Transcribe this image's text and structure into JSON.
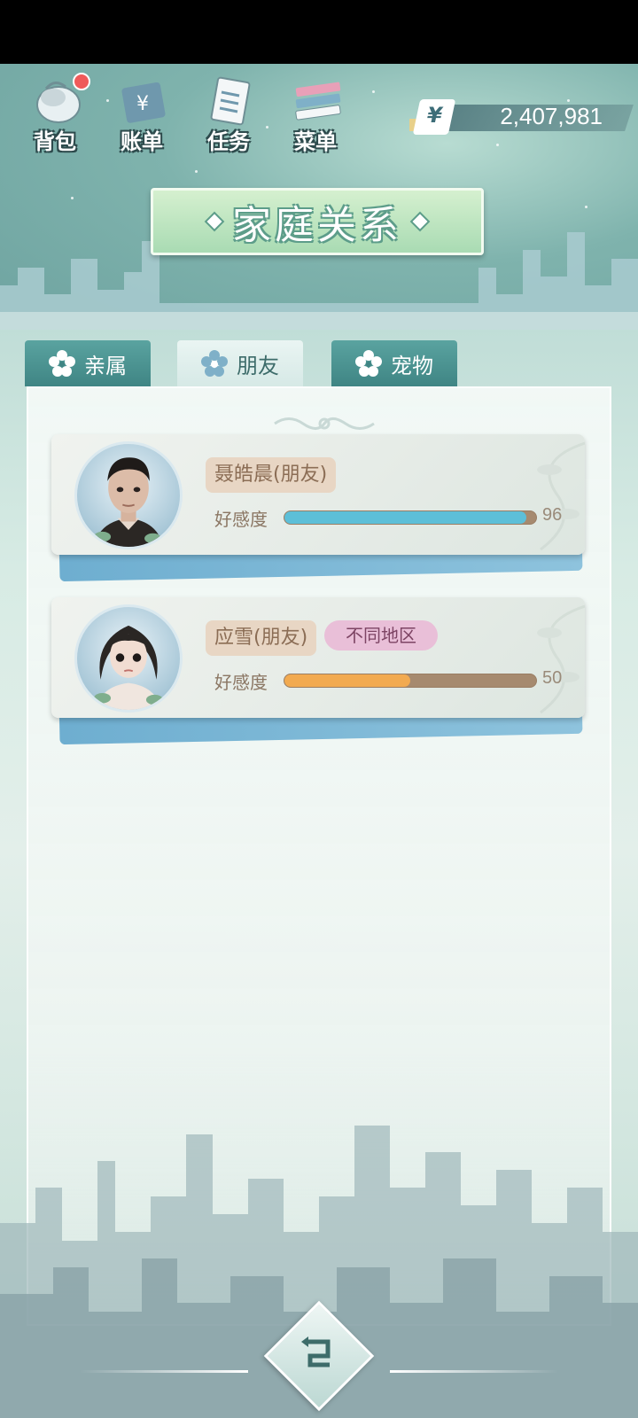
{
  "nav": {
    "bag_label": "背包",
    "bill_label": "账单",
    "task_label": "任务",
    "menu_label": "菜单"
  },
  "money": {
    "currency_symbol": "¥",
    "value": "2,407,981"
  },
  "title": "家庭关系",
  "tabs": [
    {
      "label": "亲属",
      "active": false
    },
    {
      "label": "朋友",
      "active": true
    },
    {
      "label": "宠物",
      "active": false
    }
  ],
  "friends": [
    {
      "name": "聂皓晨(朋友)",
      "region_tag": "",
      "favor_label": "好感度",
      "favor_value": "96",
      "favor_fraction": 0.96,
      "bar_color": "#5dbfd8"
    },
    {
      "name": "应雪(朋友)",
      "region_tag": "不同地区",
      "favor_label": "好感度",
      "favor_value": "50",
      "favor_fraction": 0.5,
      "bar_color": "#f2aa50"
    }
  ],
  "colors": {
    "accent": "#5aa3a0",
    "title_green": "#a9dbb3",
    "badge_red": "#ef5a5a"
  },
  "icons": {
    "back": "back-arrow-icon",
    "flower": "flower-icon"
  }
}
